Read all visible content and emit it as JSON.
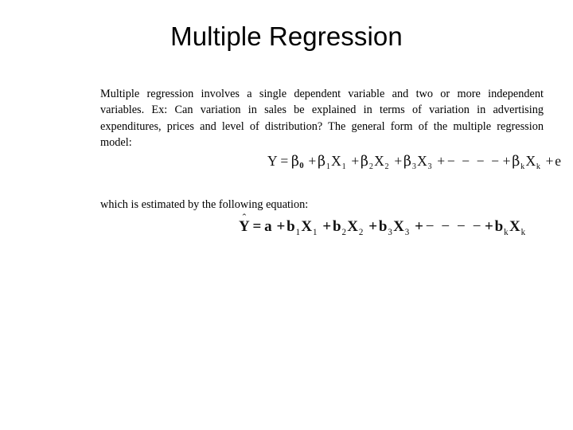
{
  "slide": {
    "title": "Multiple Regression",
    "background_color": "#ffffff",
    "text_color": "#000000",
    "body_paragraph": "Multiple regression involves a single dependent variable and two or more independent variables. Ex: Can variation in sales be explained in terms of variation in advertising expenditures, prices and level of distribution? The general form of the multiple regression model:",
    "estimate_line": "which is estimated by the following equation:",
    "equations": {
      "model": {
        "plain": "Y = β0 + β1X1 + β2X2 + β3X3 + − − − − + βkXk + e",
        "lhs": "Y",
        "equals": "=",
        "intercept": "β",
        "intercept_sub": "0",
        "terms": [
          {
            "coef": "β",
            "coef_sub": "1",
            "var": "X",
            "var_sub": "1"
          },
          {
            "coef": "β",
            "coef_sub": "2",
            "var": "X",
            "var_sub": "2"
          },
          {
            "coef": "β",
            "coef_sub": "3",
            "var": "X",
            "var_sub": "3"
          },
          {
            "coef": "β",
            "coef_sub": "k",
            "var": "X",
            "var_sub": "k"
          }
        ],
        "ellipsis": "− − − −",
        "error_term": "e",
        "plus": "+"
      },
      "estimated": {
        "plain": "Ŷ = a + b1X1 + b2X2 + b3X3 + − − − − + bkXk",
        "lhs": "Y",
        "lhs_accent": "ˆ",
        "equals": "=",
        "intercept": "a",
        "terms": [
          {
            "coef": "b",
            "coef_sub": "1",
            "var": "X",
            "var_sub": "1"
          },
          {
            "coef": "b",
            "coef_sub": "2",
            "var": "X",
            "var_sub": "2"
          },
          {
            "coef": "b",
            "coef_sub": "3",
            "var": "X",
            "var_sub": "3"
          },
          {
            "coef": "b",
            "coef_sub": "k",
            "var": "X",
            "var_sub": "k"
          }
        ],
        "ellipsis": "− − − −",
        "plus": "+"
      }
    }
  }
}
